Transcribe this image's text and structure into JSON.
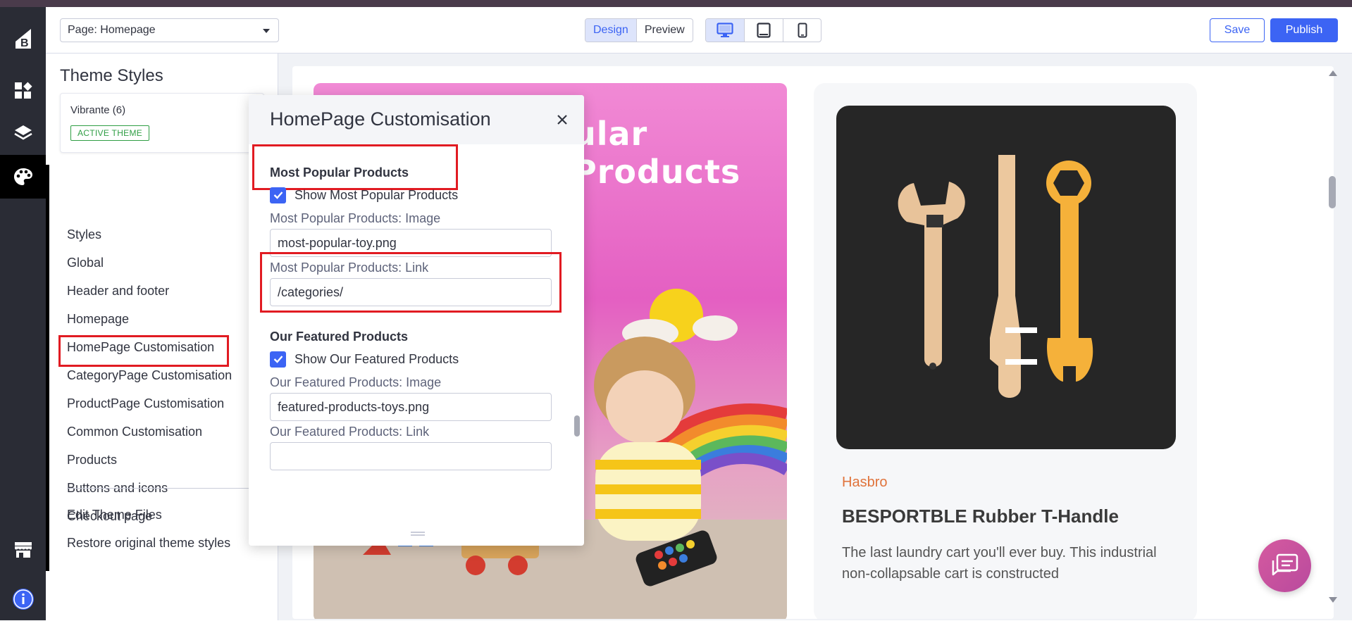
{
  "app": {
    "page_select": "Page: Homepage",
    "view_modes": [
      "Design",
      "Preview"
    ],
    "active_view_mode": "Design",
    "devices": [
      "desktop-icon",
      "tablet-icon",
      "mobile-icon"
    ],
    "active_device": "desktop-icon",
    "save_label": "Save",
    "publish_label": "Publish",
    "accent_color": "#3c64f4"
  },
  "rail": {
    "items": [
      "bigcommerce-logo-icon",
      "dashboard-icon",
      "layers-icon",
      "palette-icon",
      "storefront-icon",
      "info-icon"
    ],
    "active": "palette-icon"
  },
  "sidebar": {
    "title": "Theme Styles",
    "theme_name": "Vibrante (6)",
    "theme_badge": "ACTIVE THEME",
    "items": [
      "Styles",
      "Global",
      "Header and footer",
      "Homepage",
      "HomePage Customisation",
      "CategoryPage Customisation",
      "ProductPage Customisation",
      "Common Customisation",
      "Products",
      "Buttons and icons",
      "Checkout page"
    ],
    "highlighted_item": "HomePage Customisation",
    "footer_items": [
      "Edit Theme Files",
      "Restore original theme styles"
    ]
  },
  "modal": {
    "title": "HomePage Customisation",
    "sections": [
      {
        "heading": "Most Popular Products",
        "checkbox_label": "Show Most Popular Products",
        "checked": true,
        "image_label": "Most Popular Products: Image",
        "image_value": "most-popular-toy.png",
        "link_label": "Most Popular Products: Link",
        "link_value": "/categories/"
      },
      {
        "heading": "Our Featured Products",
        "checkbox_label": "Show Our Featured Products",
        "checked": true,
        "image_label": "Our Featured Products: Image",
        "image_value": "featured-products-toys.png",
        "link_label": "Our Featured Products: Link",
        "link_value": ""
      }
    ]
  },
  "preview": {
    "banner_title": "ular Products",
    "product": {
      "brand": "Hasbro",
      "title": "BESPORTBLE Rubber T-Handle",
      "description": "The last laundry cart you'll ever buy. This industrial non-collapsable cart is constructed"
    },
    "brand_color": "#e0733b"
  },
  "highlight_color": "#e11b22"
}
